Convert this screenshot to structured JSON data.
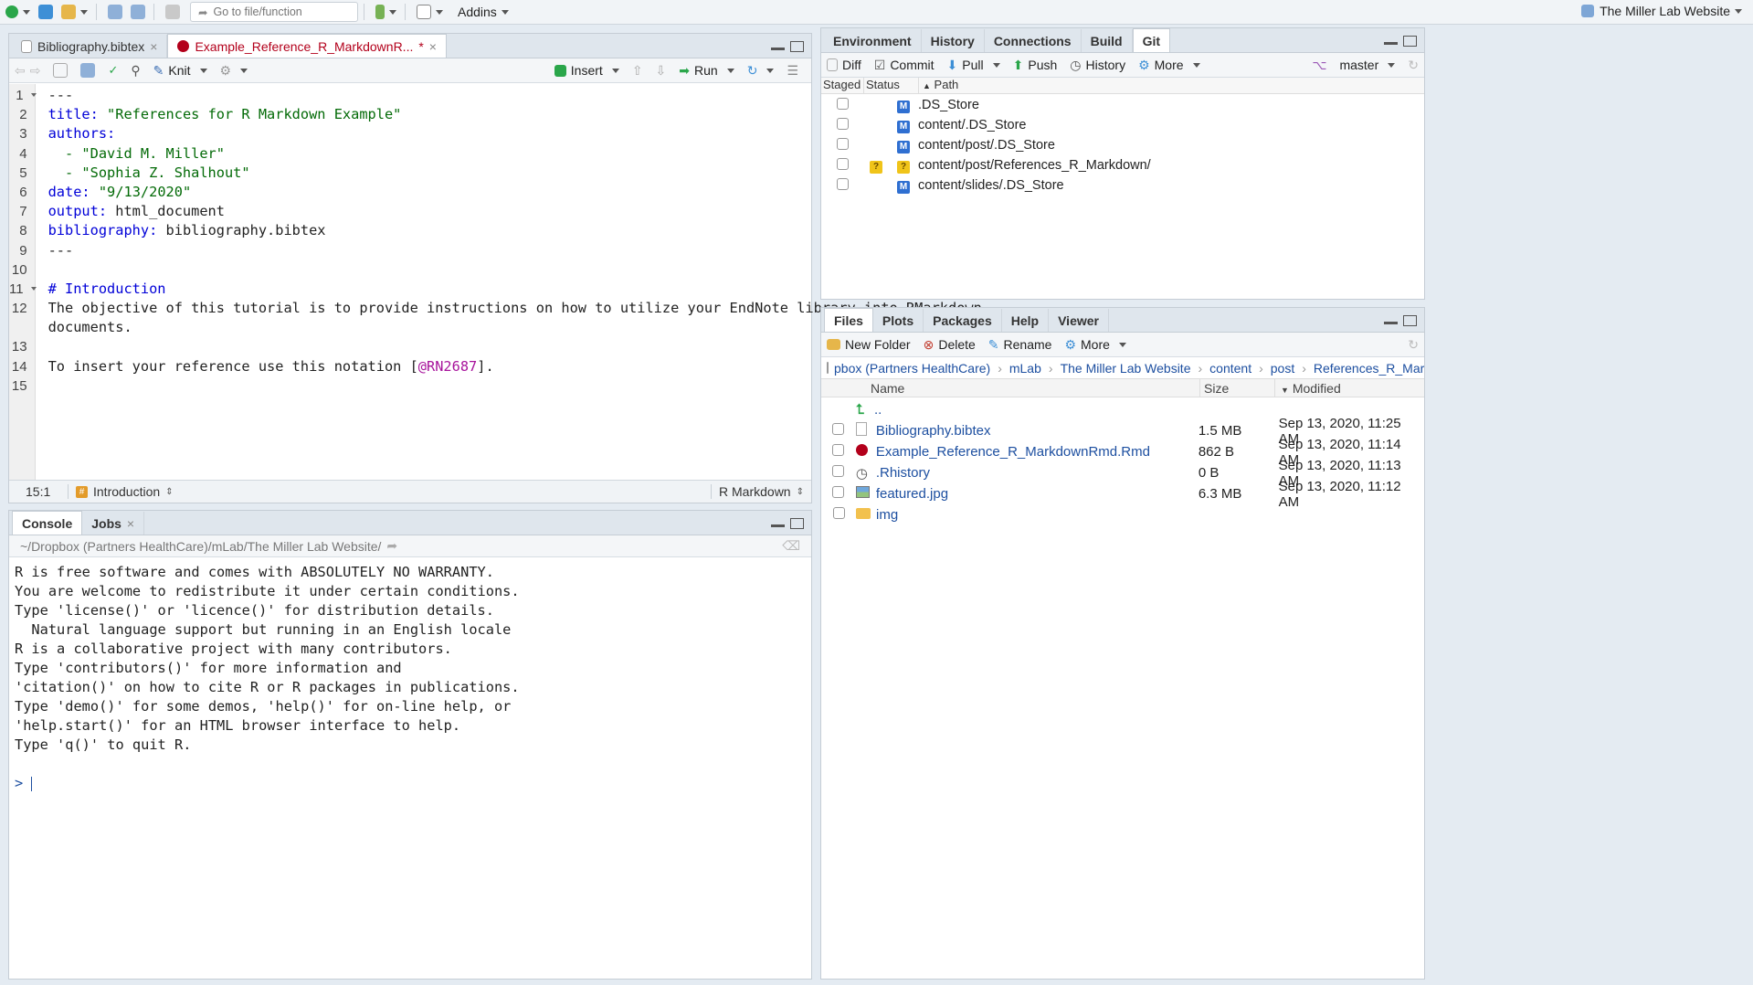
{
  "topbar": {
    "goto_placeholder": "Go to file/function",
    "addins_label": "Addins",
    "project_name": "The Miller Lab Website"
  },
  "editor": {
    "tabs": [
      {
        "label": "Bibliography.bibtex",
        "active": false
      },
      {
        "label": "Example_Reference_R_MarkdownR...",
        "active": true,
        "modified": "*"
      }
    ],
    "toolbar": {
      "knit_label": "Knit",
      "insert_label": "Insert",
      "run_label": "Run"
    },
    "line_numbers": [
      "1",
      "2",
      "3",
      "4",
      "5",
      "6",
      "7",
      "8",
      "9",
      "10",
      "11",
      "12",
      "",
      "13",
      "14",
      "15"
    ],
    "lines": {
      "l1": "---",
      "l2_key": "title:",
      "l2_val": " \"References for R Markdown Example\"",
      "l3_key": "authors:",
      "l4_val": "  - \"David M. Miller\"",
      "l5_val": "  - \"Sophia Z. Shalhout\"",
      "l6_key": "date:",
      "l6_val": " \"9/13/2020\"",
      "l7_key": "output:",
      "l7_val": " html_document",
      "l8_key": "bibliography:",
      "l8_val": " bibliography.bibtex",
      "l9": "---",
      "l11": "# Introduction",
      "l12a": "The objective of this tutorial is to provide instructions on how to utilize your EndNote library into RMarkdown",
      "l12b": "documents.",
      "l14_pre": "To insert your reference use this notation [",
      "l14_cite": "@RN2687",
      "l14_post": "]."
    },
    "status": {
      "position": "15:1",
      "section": "Introduction",
      "mode": "R Markdown"
    }
  },
  "console": {
    "tabs": [
      {
        "label": "Console",
        "active": true
      },
      {
        "label": "Jobs",
        "active": false
      }
    ],
    "path": "~/Dropbox (Partners HealthCare)/mLab/The Miller Lab Website/",
    "output": [
      "R is free software and comes with ABSOLUTELY NO WARRANTY.",
      "You are welcome to redistribute it under certain conditions.",
      "Type 'license()' or 'licence()' for distribution details.",
      "",
      "  Natural language support but running in an English locale",
      "",
      "R is a collaborative project with many contributors.",
      "Type 'contributors()' for more information and",
      "'citation()' on how to cite R or R packages in publications.",
      "",
      "Type 'demo()' for some demos, 'help()' for on-line help, or",
      "'help.start()' for an HTML browser interface to help.",
      "Type 'q()' to quit R."
    ],
    "prompt": ">"
  },
  "git_pane": {
    "tabs": [
      "Environment",
      "History",
      "Connections",
      "Build",
      "Git"
    ],
    "active_tab": "Git",
    "toolbar": {
      "diff": "Diff",
      "commit": "Commit",
      "pull": "Pull",
      "push": "Push",
      "history": "History",
      "more": "More",
      "branch": "master"
    },
    "columns": {
      "staged": "Staged",
      "status": "Status",
      "path": "Path"
    },
    "rows": [
      {
        "status1": "",
        "status2": "M",
        "path": ".DS_Store"
      },
      {
        "status1": "",
        "status2": "M",
        "path": "content/.DS_Store"
      },
      {
        "status1": "",
        "status2": "M",
        "path": "content/post/.DS_Store"
      },
      {
        "status1": "?",
        "status2": "?",
        "path": "content/post/References_R_Markdown/"
      },
      {
        "status1": "",
        "status2": "M",
        "path": "content/slides/.DS_Store"
      }
    ]
  },
  "files_pane": {
    "tabs": [
      "Files",
      "Plots",
      "Packages",
      "Help",
      "Viewer"
    ],
    "active_tab": "Files",
    "toolbar": {
      "new_folder": "New Folder",
      "delete": "Delete",
      "rename": "Rename",
      "more": "More"
    },
    "breadcrumb": [
      "pbox (Partners HealthCare)",
      "mLab",
      "The Miller Lab Website",
      "content",
      "post",
      "References_R_Markdown"
    ],
    "breadcrumb_more": "...",
    "columns": {
      "name": "Name",
      "size": "Size",
      "modified": "Modified"
    },
    "parent_dir": "..",
    "rows": [
      {
        "name": "Bibliography.bibtex",
        "size": "1.5 MB",
        "modified": "Sep 13, 2020, 11:25 AM",
        "icon": "text-file-icon"
      },
      {
        "name": "Example_Reference_R_MarkdownRmd.Rmd",
        "size": "862 B",
        "modified": "Sep 13, 2020, 11:14 AM",
        "icon": "rmd-file-icon"
      },
      {
        "name": ".Rhistory",
        "size": "0 B",
        "modified": "Sep 13, 2020, 11:13 AM",
        "icon": "history-file-icon"
      },
      {
        "name": "featured.jpg",
        "size": "6.3 MB",
        "modified": "Sep 13, 2020, 11:12 AM",
        "icon": "image-file-icon"
      },
      {
        "name": "img",
        "size": "",
        "modified": "",
        "icon": "folder-icon"
      }
    ]
  },
  "colors": {
    "accent_blue": "#1d4fa0",
    "yaml_key": "#0000d8",
    "string_green": "#036a07",
    "citation_magenta": "#a8149c",
    "active_tab_red": "#b3001b"
  }
}
